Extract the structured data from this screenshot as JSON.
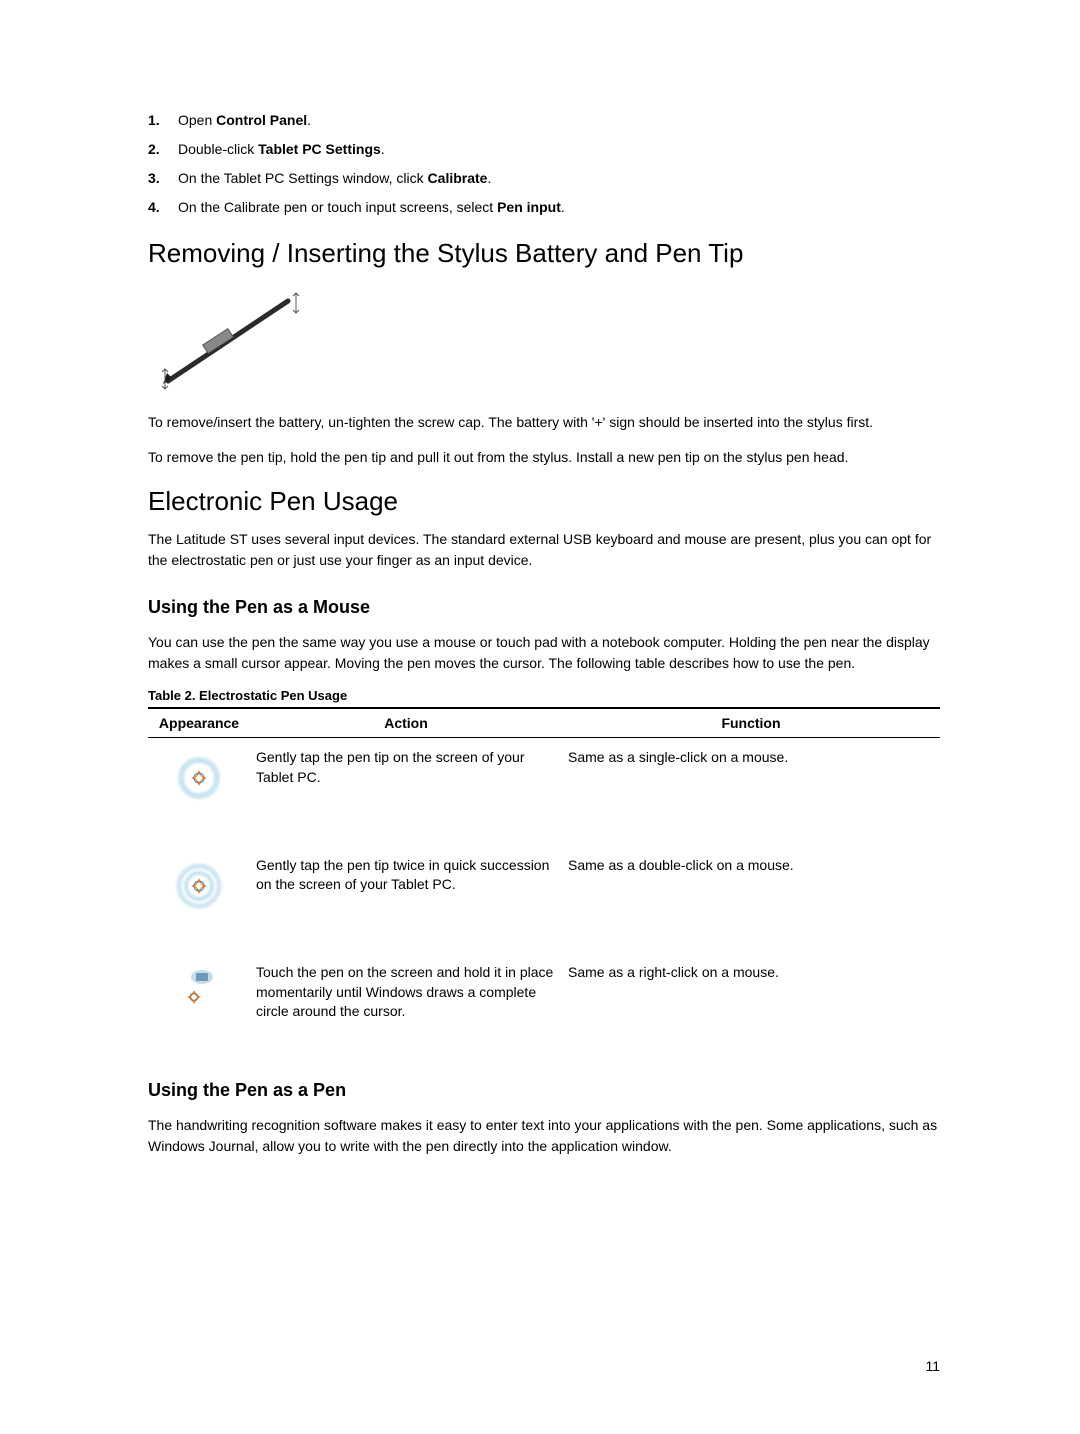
{
  "steps": [
    {
      "num": "1.",
      "prefix": "Open ",
      "bold": "Control Panel",
      "suffix": "."
    },
    {
      "num": "2.",
      "prefix": "Double-click ",
      "bold": "Tablet PC Settings",
      "suffix": "."
    },
    {
      "num": "3.",
      "prefix": "On the Tablet PC Settings window, click ",
      "bold": "Calibrate",
      "suffix": "."
    },
    {
      "num": "4.",
      "prefix": "On the Calibrate pen or touch input screens, select ",
      "bold": "Pen input",
      "suffix": "."
    }
  ],
  "heading_remove": "Removing / Inserting the Stylus Battery and Pen Tip",
  "para_remove1": "To remove/insert the battery, un-tighten the screw cap. The battery with '+' sign should be inserted into the stylus first.",
  "para_remove2": "To remove the pen tip, hold the pen tip and pull it out from the stylus. Install a new pen tip on the stylus pen head.",
  "heading_usage": "Electronic Pen Usage",
  "para_usage": "The Latitude ST uses several input devices. The standard external USB keyboard and mouse are present, plus you can opt for the electrostatic pen or just use your finger as an input device.",
  "sub_mouse": "Using the Pen as a Mouse",
  "para_mouse": "You can use the pen the same way you use a mouse or touch pad with a notebook computer. Holding the pen near the display makes a small cursor appear. Moving the pen moves the cursor. The following table describes how to use the pen.",
  "table_caption": "Table 2. Electrostatic Pen Usage",
  "table": {
    "h_appearance": "Appearance",
    "h_action": "Action",
    "h_function": "Function",
    "rows": [
      {
        "action": "Gently tap the pen tip on the screen of your Tablet PC.",
        "function": "Same as a single-click on a mouse."
      },
      {
        "action": "Gently tap the pen tip twice in quick succession on the screen of your Tablet PC.",
        "function": "Same as a double-click on a mouse."
      },
      {
        "action": "Touch the pen on the screen and hold it in place momentarily until Windows draws a complete circle around the cursor.",
        "function": "Same as a right-click on a mouse."
      }
    ]
  },
  "sub_pen": "Using the Pen as a Pen",
  "para_pen": "The handwriting recognition software makes it easy to enter text into your applications with the pen. Some applications, such as Windows Journal, allow you to write with the pen directly into the application window.",
  "page_number": "11"
}
